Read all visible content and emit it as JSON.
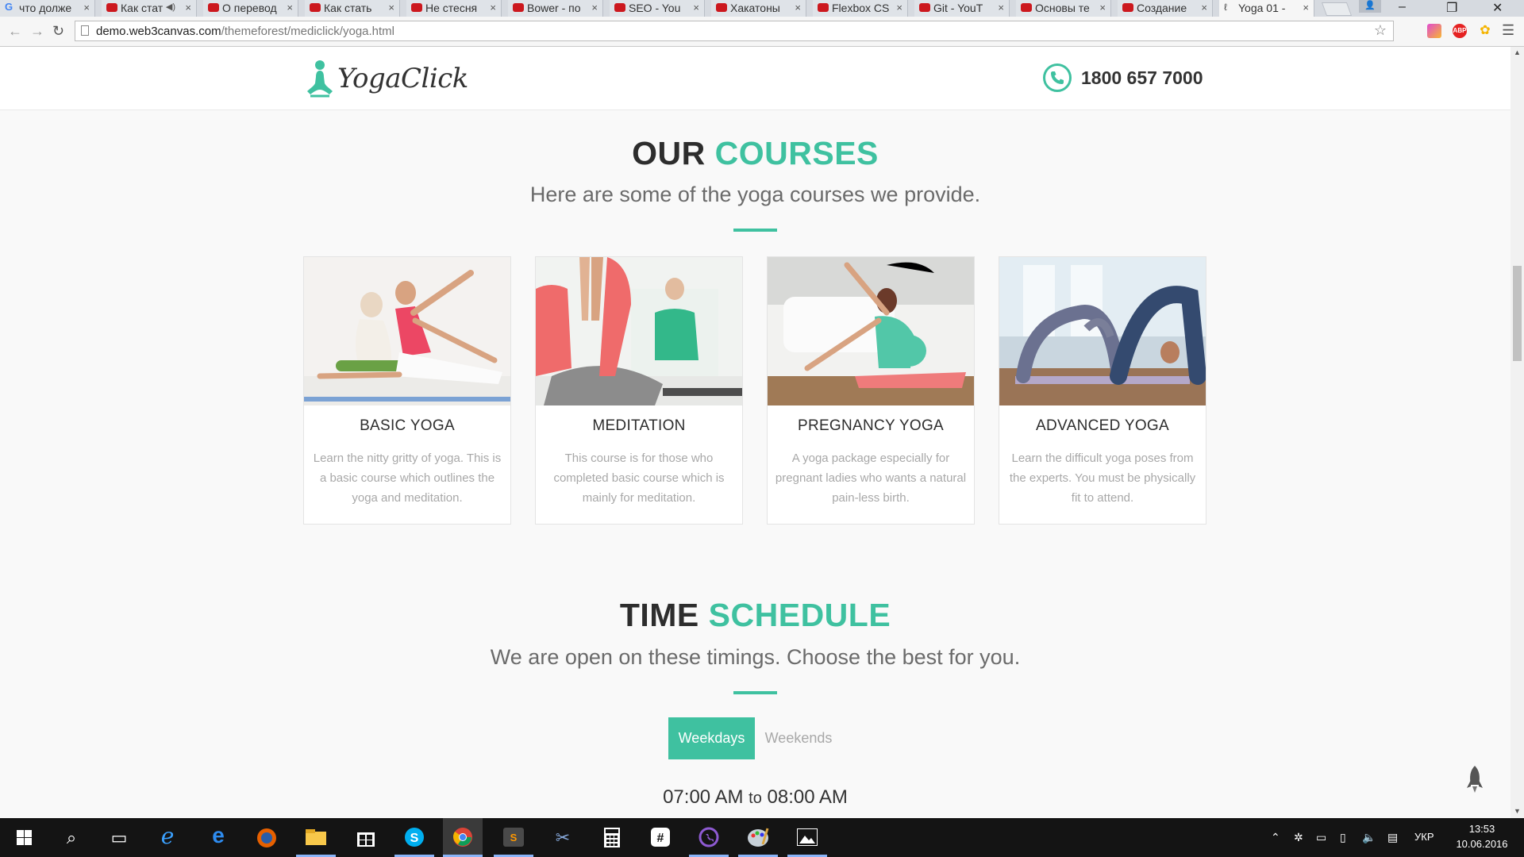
{
  "browser": {
    "tabs": [
      {
        "title": "что долже",
        "icon": "google-icon"
      },
      {
        "title": "Как стат",
        "icon": "youtube-icon",
        "audio": true
      },
      {
        "title": "О перевод",
        "icon": "youtube-icon"
      },
      {
        "title": "Как стать",
        "icon": "youtube-icon"
      },
      {
        "title": "Не стесня",
        "icon": "youtube-icon"
      },
      {
        "title": "Bower - по",
        "icon": "youtube-icon"
      },
      {
        "title": "SEO - You",
        "icon": "youtube-icon"
      },
      {
        "title": "Хакатоны",
        "icon": "youtube-icon"
      },
      {
        "title": "Flexbox CS",
        "icon": "youtube-icon"
      },
      {
        "title": "Git - YouT",
        "icon": "youtube-icon"
      },
      {
        "title": "Основы те",
        "icon": "youtube-icon"
      },
      {
        "title": "Создание",
        "icon": "youtube-icon"
      },
      {
        "title": "Yoga 01 -",
        "icon": "page-icon",
        "active": true
      }
    ],
    "tab_close": "×",
    "url_host": "demo.web3canvas.com",
    "url_path": "/themeforest/mediclick/yoga.html",
    "window_controls": {
      "minimize": "–",
      "restore": "❐",
      "close": "✕"
    }
  },
  "site": {
    "brand": "YogaClick",
    "phone": "1800 657 7000",
    "accent_color": "#3fc1a0"
  },
  "courses_section": {
    "title_dark": "OUR",
    "title_accent": "COURSES",
    "subtitle": "Here are some of the yoga courses we provide.",
    "cards": [
      {
        "name": "BASIC YOGA",
        "description": "Learn the nitty gritty of yoga. This is a basic course which outlines the yoga and meditation."
      },
      {
        "name": "MEDITATION",
        "description": "This course is for those who completed basic course which is mainly for meditation."
      },
      {
        "name": "PREGNANCY YOGA",
        "description": "A yoga package especially for pregnant ladies who wants a natural pain-less birth."
      },
      {
        "name": "ADVANCED YOGA",
        "description": "Learn the difficult yoga poses from the experts. You must be physically fit to attend."
      }
    ]
  },
  "schedule_section": {
    "title_dark": "TIME",
    "title_accent": "SCHEDULE",
    "subtitle": "We are open on these timings. Choose the best for you.",
    "tabs": [
      {
        "label": "Weekdays",
        "active": true
      },
      {
        "label": "Weekends",
        "active": false
      }
    ],
    "first_slot": {
      "start": "07:00 AM",
      "sep": "to",
      "end": "08:00 AM"
    }
  },
  "taskbar": {
    "apps": [
      "start-icon",
      "search-icon",
      "task-view-icon",
      "internet-explorer-icon",
      "edge-icon",
      "firefox-icon",
      "file-explorer-icon",
      "store-icon",
      "skype-icon",
      "chrome-icon",
      "sublime-text-icon",
      "snipping-tool-icon",
      "calculator-icon",
      "slack-icon",
      "viber-icon",
      "paint-icon",
      "photos-icon"
    ],
    "language": "УКР",
    "time": "13:53",
    "date": "10.06.2016"
  }
}
